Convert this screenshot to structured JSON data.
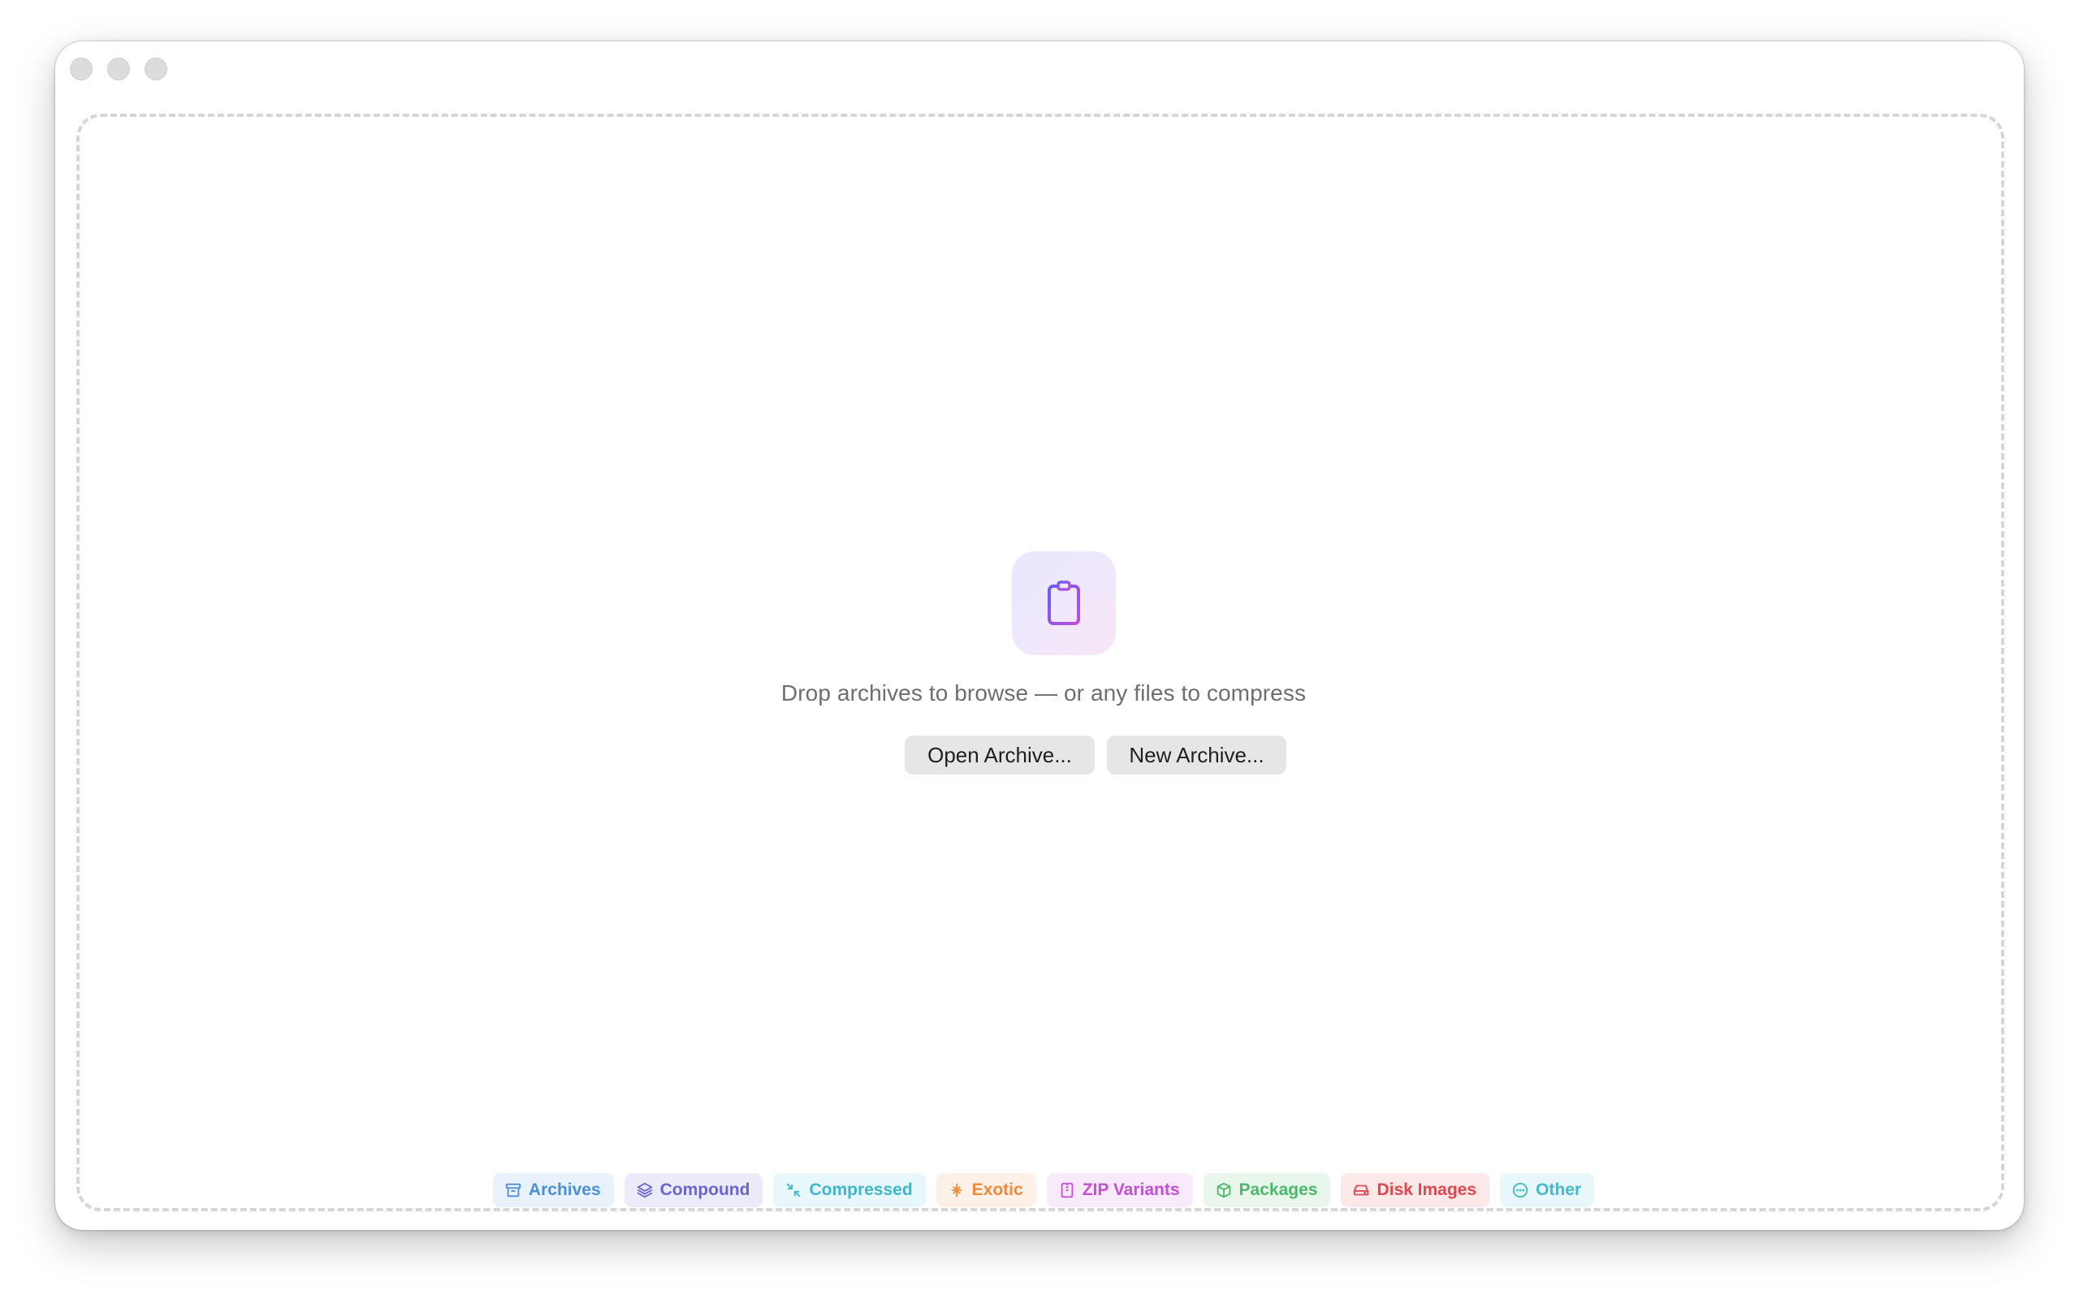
{
  "empty_state": {
    "headline": "Drop archives to browse — or any files to compress",
    "open_button": "Open Archive...",
    "new_button": "New Archive..."
  },
  "colors": {
    "icon_gradient_start": "#6a5cf0",
    "icon_gradient_end": "#c04ed8"
  },
  "format_chips": [
    {
      "label": "Archives",
      "icon": "archive-box-icon",
      "color": "#4a90d9",
      "bg": "#e9f1fb"
    },
    {
      "label": "Compound",
      "icon": "layers-icon",
      "color": "#6b63d6",
      "bg": "#ecebfa"
    },
    {
      "label": "Compressed",
      "icon": "compress-arrows-icon",
      "color": "#3eb7cf",
      "bg": "#e8f7fa"
    },
    {
      "label": "Exotic",
      "icon": "sparkle-icon",
      "color": "#ee8a3c",
      "bg": "#fdf1e7"
    },
    {
      "label": "ZIP Variants",
      "icon": "zip-file-icon",
      "color": "#c24fd6",
      "bg": "#f8eafb"
    },
    {
      "label": "Packages",
      "icon": "package-cube-icon",
      "color": "#4cb86a",
      "bg": "#e9f6ec"
    },
    {
      "label": "Disk Images",
      "icon": "disk-drive-icon",
      "color": "#e0484f",
      "bg": "#fbe9ea"
    },
    {
      "label": "Other",
      "icon": "ellipsis-circle-icon",
      "color": "#45b9c9",
      "bg": "#e8f7f9"
    }
  ]
}
